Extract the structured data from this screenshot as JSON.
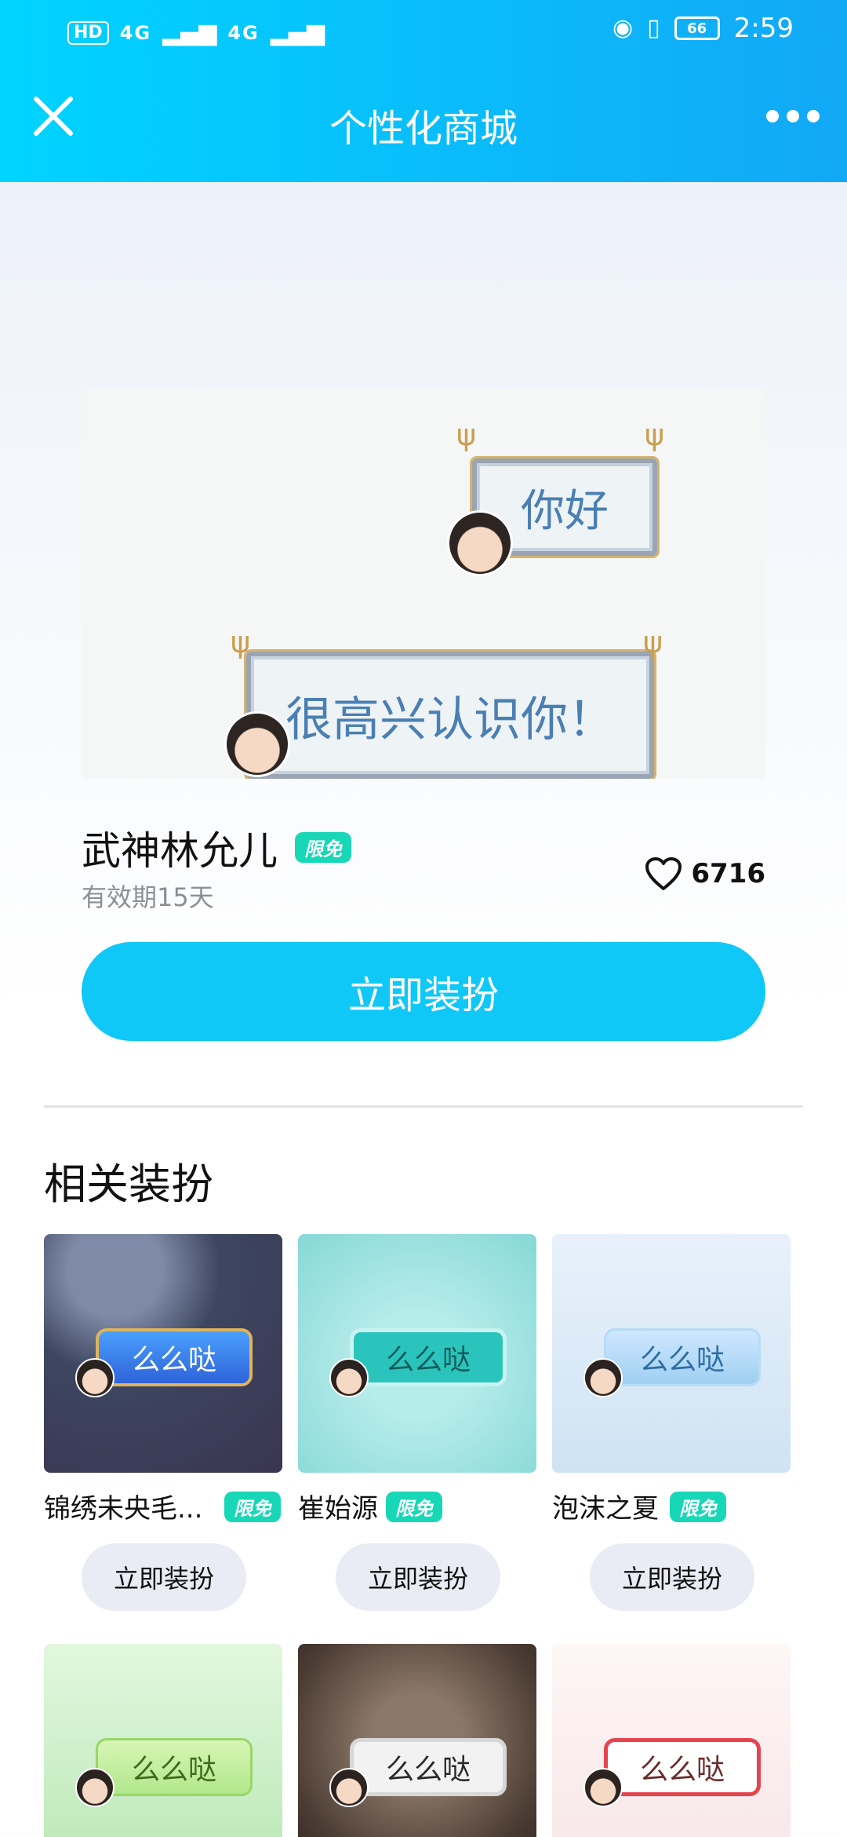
{
  "status_bar": {
    "network_left": [
      "HD",
      "4G",
      "4G"
    ],
    "battery": "66",
    "time": "2:59"
  },
  "header": {
    "title": "个性化商城",
    "close_icon": "close-icon",
    "more_icon": "more-horizontal-icon"
  },
  "preview": {
    "bubble_top_text": "你好",
    "bubble_bottom_text": "很高兴认识你！"
  },
  "item": {
    "name": "武神林允儿",
    "badge": "限免",
    "validity": "有效期15天",
    "likes": "6716",
    "primary_button": "立即装扮"
  },
  "related": {
    "title": "相关装扮",
    "items": [
      {
        "name": "锦绣未央毛...",
        "badge": "限免",
        "preview_text": "么么哒",
        "button": "立即装扮"
      },
      {
        "name": "崔始源",
        "badge": "限免",
        "preview_text": "么么哒",
        "button": "立即装扮"
      },
      {
        "name": "泡沫之夏",
        "badge": "限免",
        "preview_text": "么么哒",
        "button": "立即装扮"
      },
      {
        "preview_text": "么么哒"
      },
      {
        "preview_text": "么么哒"
      },
      {
        "preview_text": "么么哒"
      }
    ]
  },
  "colors": {
    "header_start": "#00d4ff",
    "header_end": "#12a8f6",
    "primary_button": "#10c8f7",
    "badge": "#17d7b6"
  }
}
